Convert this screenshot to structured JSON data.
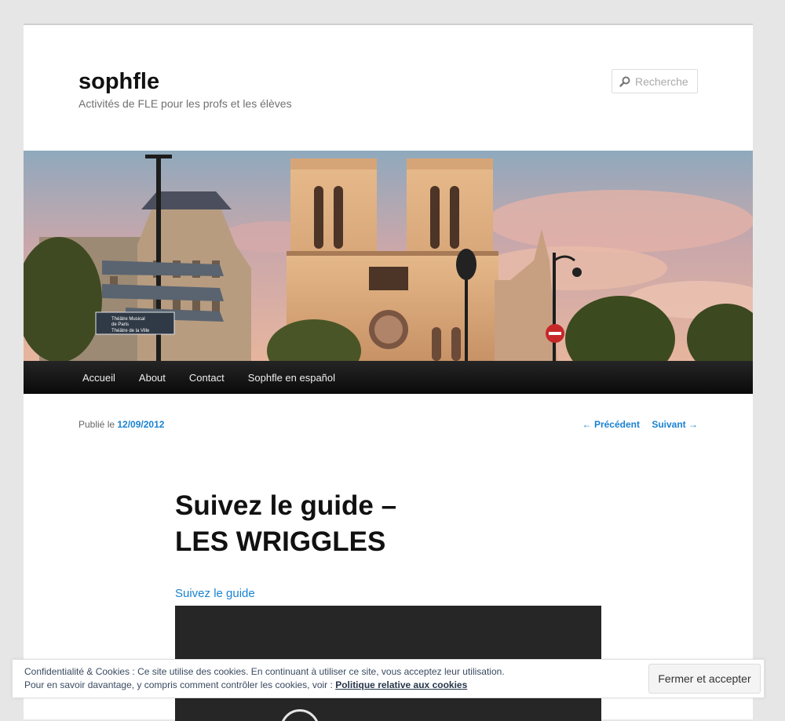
{
  "site": {
    "title": "sophfle",
    "description": "Activités de FLE pour les profs et les élèves"
  },
  "search": {
    "placeholder": "Recherche",
    "icon": "search-icon"
  },
  "nav": {
    "items": [
      {
        "label": "Accueil"
      },
      {
        "label": "About"
      },
      {
        "label": "Contact"
      },
      {
        "label": "Sophfle en español"
      }
    ]
  },
  "post": {
    "published_prefix": "Publié le",
    "date": "12/09/2012",
    "prev_label": "← Précédent",
    "next_label": "Suivant →",
    "title_line1": "Suivez le guide –",
    "title_line2": "LES WRIGGLES",
    "link_text": "Suivez le guide"
  },
  "sign": {
    "line1": "Théâtre Musical",
    "line2": "de Paris",
    "line3": "Théâtre de la Ville"
  },
  "cookie": {
    "line1": "Confidentialité & Cookies : Ce site utilise des cookies. En continuant à utiliser ce site, vous acceptez leur utilisation.",
    "line2_prefix": "Pour en savoir davantage, y compris comment contrôler les cookies, voir :",
    "policy_link": "Politique relative aux cookies",
    "accept_button": "Fermer et accepter"
  },
  "colors": {
    "link": "#1982d1",
    "nav_bg": "#111111",
    "page_bg": "#e6e6e6"
  }
}
